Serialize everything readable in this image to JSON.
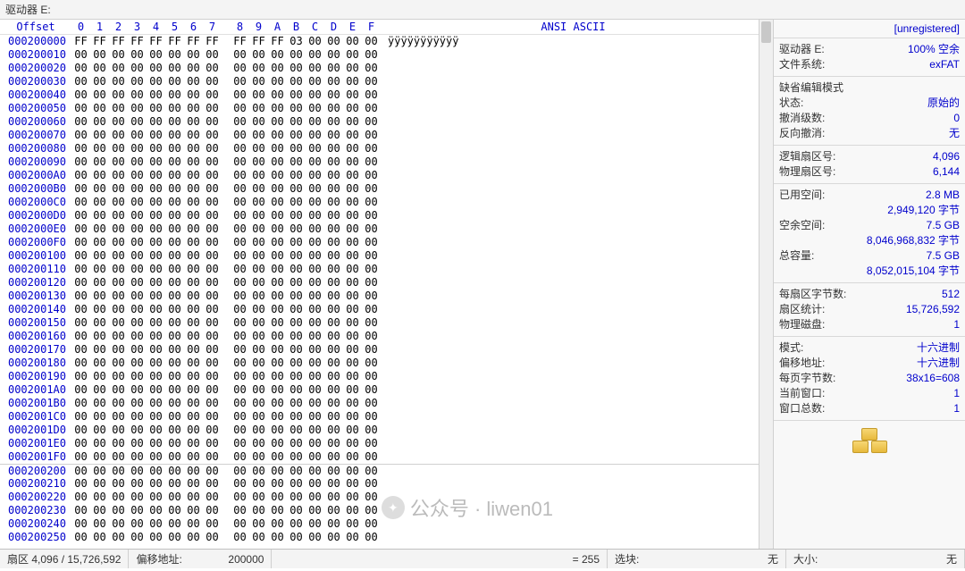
{
  "titlebar": "驱动器 E:",
  "header": {
    "offset_label": "Offset",
    "cols": [
      "0",
      "1",
      "2",
      "3",
      "4",
      "5",
      "6",
      "7",
      "8",
      "9",
      "A",
      "B",
      "C",
      "D",
      "E",
      "F"
    ],
    "ascii_label": "ANSI ASCII"
  },
  "hex": {
    "start_offset_hex": "000200000",
    "rows": 38,
    "row0_bytes": [
      "FF",
      "FF",
      "FF",
      "FF",
      "FF",
      "FF",
      "FF",
      "FF",
      "FF",
      "FF",
      "FF",
      "03",
      "00",
      "00",
      "00",
      "00"
    ],
    "row0_ascii": "ÿÿÿÿÿÿÿÿÿÿÿ",
    "zero_byte": "00",
    "separator_after_row": 31
  },
  "side": {
    "unregistered": "[unregistered]",
    "drive_label_k": "驱动器 E:",
    "drive_label_v": "100% 空余",
    "fs_k": "文件系统:",
    "fs_v": "exFAT",
    "edit_mode_title": "缺省编辑模式",
    "state_k": "状态:",
    "state_v": "原始的",
    "undo_k": "撤消级数:",
    "undo_v": "0",
    "redo_k": "反向撤消:",
    "redo_v": "无",
    "lsect_k": "逻辑扇区号:",
    "lsect_v": "4,096",
    "psect_k": "物理扇区号:",
    "psect_v": "6,144",
    "used_k": "已用空间:",
    "used_v": "2.8 MB",
    "used_bytes": "2,949,120 字节",
    "free_k": "空余空间:",
    "free_v": "7.5 GB",
    "free_bytes": "8,046,968,832 字节",
    "total_k": "总容量:",
    "total_v": "7.5 GB",
    "total_bytes": "8,052,015,104 字节",
    "bps_k": "每扇区字节数:",
    "bps_v": "512",
    "sects_k": "扇区统计:",
    "sects_v": "15,726,592",
    "disk_k": "物理磁盘:",
    "disk_v": "1",
    "mode_k": "模式:",
    "mode_v": "十六进制",
    "offaddr_k": "偏移地址:",
    "offaddr_v": "十六进制",
    "bpp_k": "每页字节数:",
    "bpp_v": "38x16=608",
    "curwin_k": "当前窗口:",
    "curwin_v": "1",
    "totwin_k": "窗口总数:",
    "totwin_v": "1"
  },
  "status": {
    "sector": "扇区 4,096 / 15,726,592",
    "offset_label": "偏移地址:",
    "offset_value": "200000",
    "eq_label": "= 255",
    "sel_label": "选块:",
    "sel_value": "无",
    "size_label": "大小:",
    "size_value": "无"
  },
  "watermark": {
    "text": "公众号 · liwen01"
  }
}
